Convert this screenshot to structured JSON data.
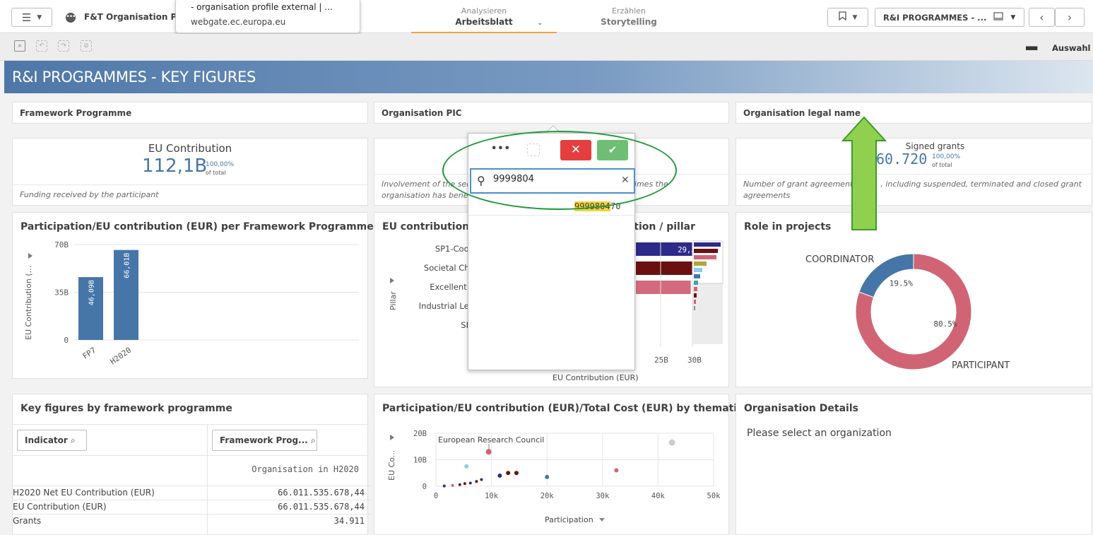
{
  "toolbar": {
    "app_title": "F&T Organisation Prof",
    "tooltip_title": "- organisation profile external | ...",
    "tooltip_url": "webgate.ec.europa.eu",
    "analyse_sub": "Analysieren",
    "analyse_main": "Arbeitsblatt",
    "story_sub": "Erzählen",
    "story_main": "Storytelling",
    "sheet_name": "R&I PROGRAMMES - ...",
    "selections_label": "Auswahl"
  },
  "sheet": {
    "title": "R&I PROGRAMMES - KEY FIGURES"
  },
  "filters": {
    "framework": "Framework Programme",
    "pic": "Organisation PIC",
    "legal_name": "Organisation legal name"
  },
  "kpi_eu": {
    "label": "EU Contribution",
    "value": "112,1B",
    "pct": "100,00%",
    "of_total": "of total",
    "footer": "Funding received by the participant"
  },
  "kpi_mid": {
    "footer_left": "Involvement of the sele",
    "footer_right": "umber of times the",
    "footer_line2": "organisation has bene"
  },
  "kpi_grants": {
    "label": "Signed grants",
    "value": "60.720",
    "pct": "100,00%",
    "of_total": "of total",
    "footer_a": "Number of grant agreements s",
    "footer_b": ", including suspended, terminated and closed grant",
    "footer_c": "agreements"
  },
  "chart_fp": {
    "title": "Participation/EU contribution (EUR) per Framework Programme",
    "ylabel": "EU Contribution (...",
    "yticks": [
      "70B",
      "35B",
      "0"
    ]
  },
  "chart_pillar": {
    "title_left": "EU contribution (E",
    "title_right": "ction / pillar",
    "ylabel": "Pillar",
    "xlabel": "EU Contribution (EUR)",
    "xticks": [
      "25B",
      "30B"
    ],
    "rows": [
      "SP1-Coope",
      "Societal Chall",
      "Excellent Sc",
      "Industrial Lead",
      "SP2-"
    ]
  },
  "chart_role": {
    "title": "Role in projects",
    "label_coord": "COORDINATOR",
    "label_part": "PARTICIPANT"
  },
  "table_kf": {
    "title": "Key figures by framework programme",
    "col1_header": "Indicator",
    "col2_header": "Framework Prog...",
    "col2_sub": "Organisation in H2020",
    "rows": [
      {
        "label": "H2020 Net EU Contribution (EUR)",
        "value": "66.011.535.678,44"
      },
      {
        "label": "EU Contribution (EUR)",
        "value": "66.011.535.678,44"
      },
      {
        "label": "Grants",
        "value": "34.911"
      }
    ]
  },
  "chart_scatter": {
    "title": "Participation/EU contribution (EUR)/Total Cost (EUR) by thematic pr...",
    "annotation": "European Research Council",
    "ylabel": "EU Co...",
    "xlabel": "Participation",
    "yticks": [
      "20B",
      "10B",
      "0"
    ],
    "xticks": [
      "0",
      "10k",
      "20k",
      "30k",
      "40k",
      "50k"
    ]
  },
  "org_details": {
    "title": "Organisation Details",
    "body": "Please select an organization"
  },
  "listbox": {
    "more": "•••",
    "search_value": "9999804",
    "result_match": "9999804",
    "result_rest": "70"
  },
  "chart_data": [
    {
      "type": "bar",
      "title": "Participation/EU contribution (EUR) per Framework Programme",
      "categories": [
        "FP7",
        "H2020"
      ],
      "values": [
        46.09,
        66.01
      ],
      "value_labels": [
        "46,09B",
        "66,01B"
      ],
      "unit": "B EUR",
      "ylabel": "EU Contribution (...",
      "ylim": [
        0,
        70
      ],
      "color": "#4676a8"
    },
    {
      "type": "bar",
      "orientation": "horizontal",
      "title": "EU contribution (E… ction / pillar",
      "categories": [
        "SP1-Coope",
        "Societal Chall",
        "Excellent Sc",
        "Industrial Lead",
        "SP2-"
      ],
      "values": [
        29.39,
        25.04,
        24.27,
        null,
        null
      ],
      "value_labels": [
        "29,39B",
        "25,04B",
        "24,27B"
      ],
      "colors": [
        "#2d2a8a",
        "#6b1010",
        "#d46a7e"
      ]
    },
    {
      "type": "pie",
      "title": "Role in projects",
      "labels": [
        "COORDINATOR",
        "PARTICIPANT"
      ],
      "values": [
        19.5,
        80.5
      ],
      "colors": [
        "#4676a8",
        "#d06475"
      ]
    },
    {
      "type": "scatter",
      "title": "Participation/EU contribution (EUR)/Total Cost (EUR) by thematic pr...",
      "xlabel": "Participation",
      "ylabel": "EU Co...",
      "xlim": [
        0,
        50000
      ],
      "ylim": [
        0,
        20
      ],
      "points": [
        {
          "x": 9500,
          "y": 13,
          "color": "#d06475"
        },
        {
          "x": 42500,
          "y": 16.5,
          "color": "#cccccc"
        },
        {
          "x": 5500,
          "y": 7.5,
          "color": "#8cc9ee"
        },
        {
          "x": 32500,
          "y": 6,
          "color": "#d06475"
        },
        {
          "x": 20000,
          "y": 3.5,
          "color": "#4676a8"
        },
        {
          "x": 14500,
          "y": 5,
          "color": "#6b1010"
        },
        {
          "x": 13000,
          "y": 5,
          "color": "#6b1010"
        },
        {
          "x": 11500,
          "y": 4,
          "color": "#2d2a8a"
        },
        {
          "x": 8200,
          "y": 2.5,
          "color": "#2d2a8a"
        },
        {
          "x": 7300,
          "y": 1.8,
          "color": "#6b1010"
        },
        {
          "x": 6200,
          "y": 1.2,
          "color": "#2d2a8a"
        },
        {
          "x": 5200,
          "y": 1.0,
          "color": "#6b1010"
        },
        {
          "x": 4300,
          "y": 0.6,
          "color": "#2d2a8a"
        },
        {
          "x": 3000,
          "y": 0.3,
          "color": "#d06475"
        },
        {
          "x": 1500,
          "y": 0.1,
          "color": "#2d2a8a"
        }
      ]
    }
  ]
}
